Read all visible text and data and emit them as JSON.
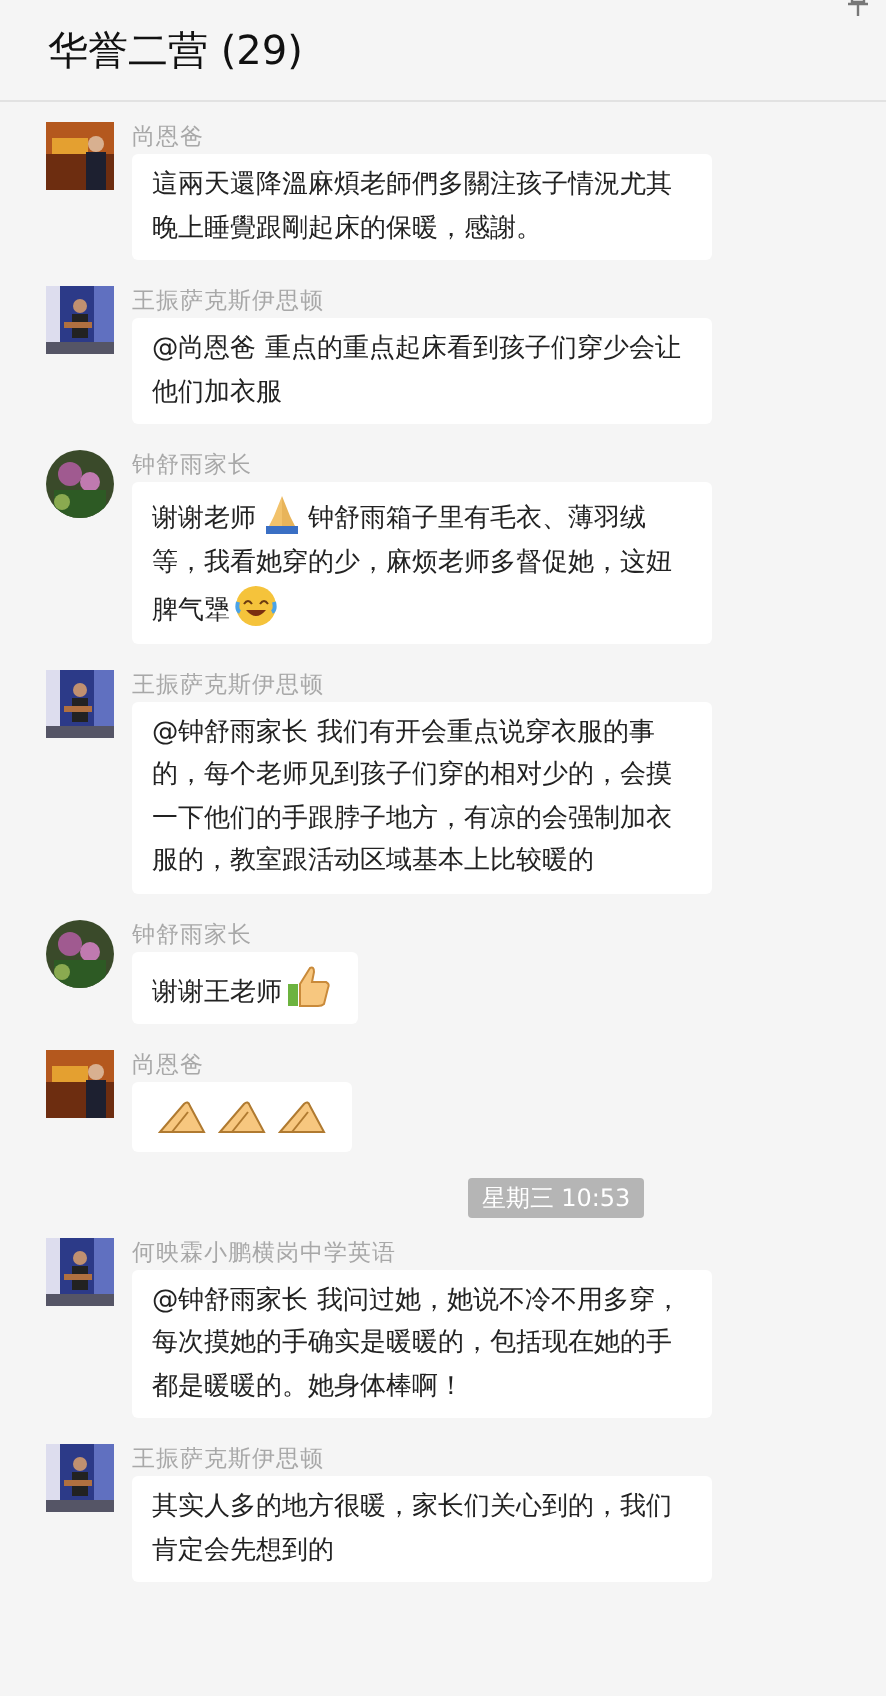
{
  "header": {
    "title": "华誉二营 (29)"
  },
  "messages": [
    {
      "kind": "message",
      "sender": "尚恩爸",
      "round_avatar": false,
      "parts": [
        {
          "kind": "text",
          "text": "這兩天還降溫麻煩老師們多關注孩子情況尤其晚上睡覺跟剛起床的保暖，感謝。"
        }
      ]
    },
    {
      "kind": "message",
      "sender": "王振萨克斯伊思顿",
      "round_avatar": false,
      "parts": [
        {
          "kind": "text",
          "text": "@尚恩爸 重点的重点起床看到孩子们穿少会让他们加衣服"
        }
      ]
    },
    {
      "kind": "message",
      "sender": "钟舒雨家长",
      "round_avatar": true,
      "parts": [
        {
          "kind": "text",
          "text": "谢谢老师"
        },
        {
          "kind": "folded-hands"
        },
        {
          "kind": "text",
          "text": "钟舒雨箱子里有毛衣、薄羽绒等，我看她穿的少，麻烦老师多督促她，这妞脾气犟"
        },
        {
          "kind": "laughing-crying"
        }
      ]
    },
    {
      "kind": "message",
      "sender": "王振萨克斯伊思顿",
      "round_avatar": false,
      "parts": [
        {
          "kind": "text",
          "text": "@钟舒雨家长 我们有开会重点说穿衣服的事的，每个老师见到孩子们穿的相对少的，会摸一下他们的手跟脖子地方，有凉的会强制加衣服的，教室跟活动区域基本上比较暖的"
        }
      ]
    },
    {
      "kind": "message",
      "sender": "钟舒雨家长",
      "round_avatar": true,
      "parts": [
        {
          "kind": "text",
          "text": "谢谢王老师"
        },
        {
          "kind": "thumbs-up"
        }
      ]
    },
    {
      "kind": "message",
      "sender": "尚恩爸",
      "round_avatar": false,
      "parts": [
        {
          "kind": "hands-together"
        },
        {
          "kind": "hands-together"
        },
        {
          "kind": "hands-together"
        }
      ]
    },
    {
      "kind": "time",
      "text": "星期三 10:53"
    },
    {
      "kind": "message",
      "sender": "何映霖小鹏横岗中学英语",
      "round_avatar": false,
      "parts": [
        {
          "kind": "text",
          "text": "@钟舒雨家长 我问过她，她说不冷不用多穿，每次摸她的手确实是暖暖的，包括现在她的手都是暖暖的。她身体棒啊！"
        }
      ]
    },
    {
      "kind": "message",
      "sender": "王振萨克斯伊思顿",
      "round_avatar": false,
      "parts": [
        {
          "kind": "text",
          "text": "其实人多的地方很暖，家长们关心到的，我们肯定会先想到的"
        }
      ]
    }
  ]
}
